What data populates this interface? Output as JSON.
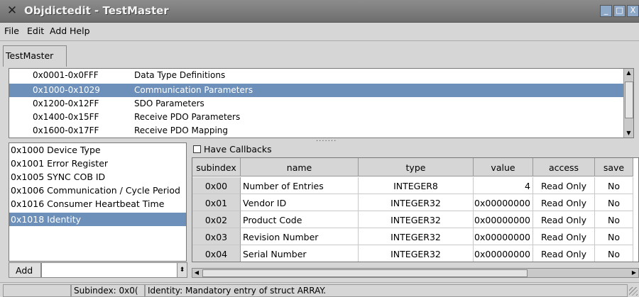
{
  "window": {
    "title": "Objdictedit - TestMaster",
    "min": "_",
    "max": "□",
    "close": "X",
    "app_icon": "✕"
  },
  "menu": [
    "File",
    "Edit",
    "Add",
    "Help"
  ],
  "tab": {
    "label": "TestMaster"
  },
  "groups": [
    {
      "range": "0x0001-0x0FFF",
      "name": "Data Type Definitions",
      "selected": false
    },
    {
      "range": "0x1000-0x1029",
      "name": "Communication Parameters",
      "selected": true
    },
    {
      "range": "0x1200-0x12FF",
      "name": "SDO Parameters",
      "selected": false
    },
    {
      "range": "0x1400-0x15FF",
      "name": "Receive PDO Parameters",
      "selected": false
    },
    {
      "range": "0x1600-0x17FF",
      "name": "Receive PDO Mapping",
      "selected": false
    }
  ],
  "splitter": "·······",
  "indexes": [
    {
      "text": "0x1000  Device Type",
      "selected": false
    },
    {
      "text": "0x1001  Error Register",
      "selected": false
    },
    {
      "text": "0x1005  SYNC COB ID",
      "selected": false
    },
    {
      "text": "0x1006  Communication / Cycle Period",
      "selected": false
    },
    {
      "text": "0x1016  Consumer Heartbeat Time",
      "selected": false
    },
    {
      "text": "0x1018  Identity",
      "selected": true
    }
  ],
  "add_button": "Add",
  "have_callbacks": "Have Callbacks",
  "table": {
    "columns": [
      "subindex",
      "name",
      "type",
      "value",
      "access",
      "save"
    ],
    "rows": [
      [
        "0x00",
        "Number of Entries",
        "INTEGER8",
        "4",
        "Read Only",
        "No"
      ],
      [
        "0x01",
        "Vendor ID",
        "INTEGER32",
        "0x00000000",
        "Read Only",
        "No"
      ],
      [
        "0x02",
        "Product Code",
        "INTEGER32",
        "0x00000000",
        "Read Only",
        "No"
      ],
      [
        "0x03",
        "Revision Number",
        "INTEGER32",
        "0x00000000",
        "Read Only",
        "No"
      ],
      [
        "0x04",
        "Serial Number",
        "INTEGER32",
        "0x00000000",
        "Read Only",
        "No"
      ]
    ]
  },
  "status": {
    "field1": "",
    "field2": "Subindex: 0x0(",
    "field3": "Identity: Mandatory entry of struct ARRAY."
  }
}
